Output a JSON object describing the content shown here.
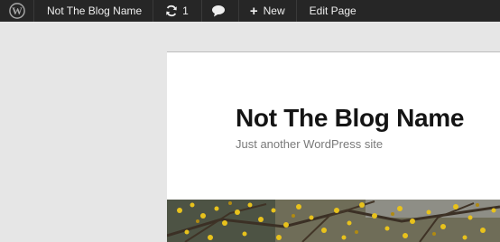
{
  "admin_bar": {
    "logo_icon": "wordpress-logo-icon",
    "site_name": "Not The Blog Name",
    "updates_icon": "refresh-icon",
    "updates_count": "1",
    "comments_icon": "speech-bubble-icon",
    "new_icon": "plus-icon",
    "new_label": "New",
    "edit_label": "Edit Page"
  },
  "site": {
    "title": "Not The Blog Name",
    "description": "Just another WordPress site"
  },
  "header_image": {
    "subject": "yellow flowering branches"
  }
}
